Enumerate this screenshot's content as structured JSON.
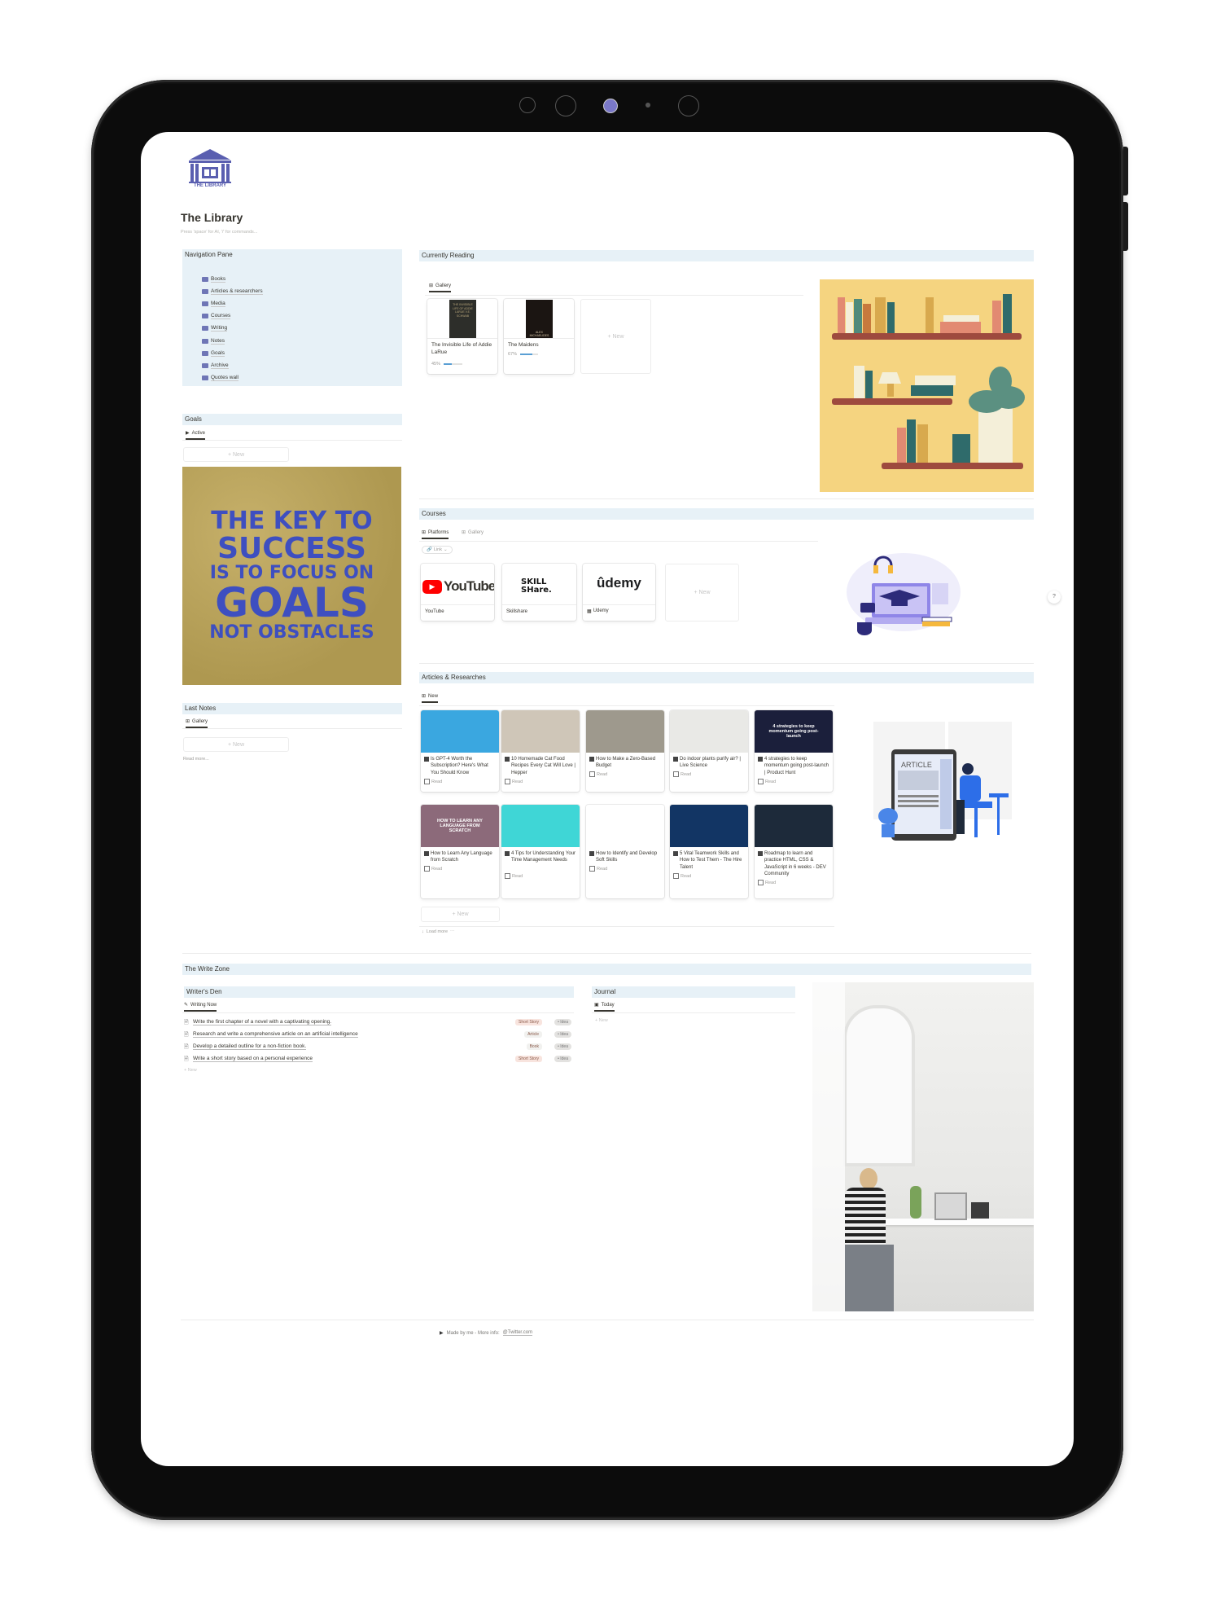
{
  "page": {
    "title": "The Library",
    "hint": "Press 'space' for AI, '/' for commands...",
    "logo_text": "THE LIBRARY"
  },
  "navigation": {
    "header": "Navigation Pane",
    "items": [
      {
        "label": "Books",
        "icon": "books-icon"
      },
      {
        "label": "Articles & researchers",
        "icon": "articles-icon"
      },
      {
        "label": "Media",
        "icon": "media-icon"
      },
      {
        "label": "Courses",
        "icon": "courses-icon"
      },
      {
        "label": "Writing",
        "icon": "writing-icon"
      },
      {
        "label": "Notes",
        "icon": "notes-icon"
      },
      {
        "label": "Goals",
        "icon": "goals-icon"
      },
      {
        "label": "Archive",
        "icon": "archive-icon"
      },
      {
        "label": "Quotes wall",
        "icon": "quotes-icon"
      }
    ]
  },
  "goals": {
    "header": "Goals",
    "tab": "Active",
    "new_label": "+ New",
    "quote_lines": [
      "THE KEY TO",
      "SUCCESS",
      "IS TO FOCUS ON",
      "GOALS",
      "NOT OBSTACLES"
    ]
  },
  "last_notes": {
    "header": "Last Notes",
    "tab": "Gallery",
    "new_label": "+ New",
    "read_more": "Read more..."
  },
  "currently_reading": {
    "header": "Currently Reading",
    "tab": "Gallery",
    "new_label": "+ New",
    "books": [
      {
        "title": "The Invisible Life of Addie LaRue",
        "cover_text": "THE INVISIBLE LIFE OF ADDIE LARUE V.E. SCHWAB",
        "progress_label": "45%",
        "progress": 0.45
      },
      {
        "title": "The Maidens",
        "cover_text": "ALEX MICHAELIDES",
        "progress_label": "67%",
        "progress": 0.67
      }
    ]
  },
  "courses": {
    "header": "Courses",
    "tabs": [
      "Platforms",
      "Gallery"
    ],
    "filter": "Link",
    "new_label": "+ New",
    "platforms": [
      {
        "name": "YouTube",
        "logo": "YouTube"
      },
      {
        "name": "Skillshare",
        "logo": "SKILL SHare."
      },
      {
        "name": "Udemy",
        "logo": "ûdemy"
      }
    ]
  },
  "articles": {
    "header": "Articles & Researches",
    "tab": "New",
    "check_label": "Read",
    "new_label": "+ New",
    "load_more": "Load more",
    "items": [
      {
        "title": "Is GPT-4 Worth the Subscription? Here's What You Should Know",
        "cover": "#3aa7e0"
      },
      {
        "title": "10 Homemade Cat Food Recipes Every Cat Will Love | Hepper",
        "cover": "#cfc6b8"
      },
      {
        "title": "How to Make a Zero-Based Budget",
        "cover": "#9e998d"
      },
      {
        "title": "Do indoor plants purify air? | Live Science",
        "cover": "#e9e9e6"
      },
      {
        "title": "4 strategies to keep momentum going post-launch | Product Hunt",
        "cover": "#1b1f3b",
        "cover_text": "4 strategies to keep momentum going post-launch"
      },
      {
        "title": "How to Learn Any Language from Scratch",
        "cover": "#8c6a7a",
        "cover_text": "HOW TO LEARN ANY LANGUAGE FROM SCRATCH"
      },
      {
        "title": "4 Tips for Understanding Your Time Management Needs",
        "cover": "#3fd6d6"
      },
      {
        "title": "How to Identify and Develop Soft Skills",
        "cover": "#ffffff"
      },
      {
        "title": "5 Vital Teamwork Skills and How to Test Them - The Hire Talent",
        "cover": "#123564"
      },
      {
        "title": "Roadmap to learn and practice HTML, CSS & JavaScript in 6 weeks - DEV Community",
        "cover": "#1d2a3a"
      }
    ]
  },
  "write_zone": {
    "header": "The Write Zone",
    "writers_den": {
      "header": "Writer's Den",
      "tab": "Writing Now",
      "new_label": "+ New",
      "rows": [
        {
          "title": "Write the first chapter of a novel with a captivating opening.",
          "type": "Short Story",
          "status": "Idea"
        },
        {
          "title": "Research and write a comprehensive article on an artificial intelligence",
          "type": "Article",
          "status": "Idea"
        },
        {
          "title": "Develop a detailed outline for a non-fiction book.",
          "type": "Book",
          "status": "Idea"
        },
        {
          "title": "Write a short story based on a personal experience",
          "type": "Short Story",
          "status": "Idea"
        }
      ]
    },
    "journal": {
      "header": "Journal",
      "tab": "Today",
      "new_label": "+ New"
    }
  },
  "footer": {
    "text": "Made by me - More info:",
    "link": "@Twitter.com"
  },
  "help_button": "?",
  "colors": {
    "header_bg": "#e7f1f7",
    "logo_blue": "#5a5fb0",
    "progress_blue": "#5a9fd4",
    "short_story_tag": "#f8e4de",
    "article_tag": "#f1f1ef",
    "idea_tag": "#e3e2e0"
  }
}
